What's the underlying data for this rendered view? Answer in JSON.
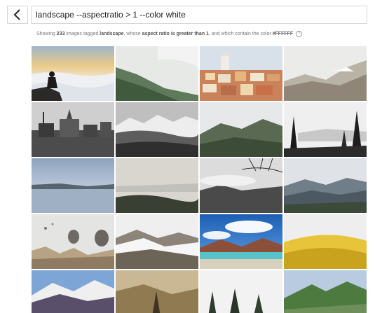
{
  "search": {
    "query": "landscape --aspectratio > 1 --color white"
  },
  "summary": {
    "prefix": "Showing ",
    "count": "233",
    "mid1": " images tagged ",
    "tag": "landscape",
    "mid2": ", whose ",
    "ratio": "aspect ratio is greater than 1",
    "mid3": ", and which contain the color ",
    "color": "#FFFFFF",
    "help": "?"
  },
  "icons": {
    "back": "chevron-left-icon",
    "help": "help-circle-icon"
  },
  "tiles": [
    "photo-tile",
    "photo-tile",
    "photo-tile",
    "photo-tile",
    "photo-tile",
    "photo-tile",
    "photo-tile",
    "photo-tile",
    "photo-tile",
    "photo-tile",
    "photo-tile",
    "photo-tile",
    "photo-tile",
    "photo-tile",
    "photo-tile",
    "photo-tile",
    "photo-tile",
    "photo-tile",
    "photo-tile",
    "photo-tile"
  ]
}
